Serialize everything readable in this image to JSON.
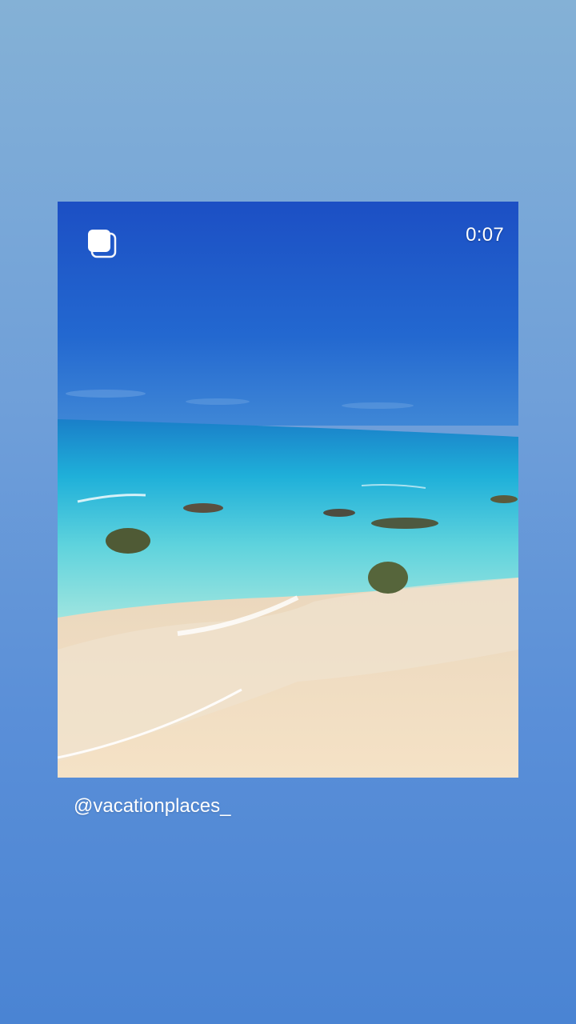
{
  "post": {
    "duration": "0:07",
    "username": "@vacationplaces_",
    "media_type_icon": "multiple-media-icon",
    "media_alt": "beach-video-thumbnail"
  },
  "colors": {
    "background_top": "#84b1d6",
    "background_bottom": "#4a84d3",
    "sky": "#1e5cc8",
    "sea": "#2ec2d8",
    "sand": "#f1dcbd",
    "text": "#ffffff"
  }
}
